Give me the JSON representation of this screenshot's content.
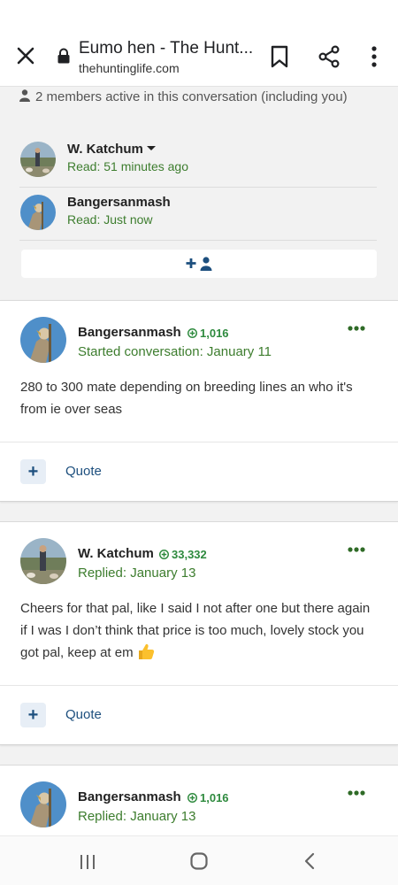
{
  "browser": {
    "title": "Eumo hen - The Hunt...",
    "url": "thehuntinglife.com"
  },
  "members": {
    "summary": "2 members active in this conversation (including you)",
    "list": [
      {
        "name": "W. Katchum",
        "read": "Read: 51 minutes ago",
        "has_dropdown": true
      },
      {
        "name": "Bangersanmash",
        "read": "Read: Just now",
        "has_dropdown": false
      }
    ],
    "invite_icon": "add-user-icon"
  },
  "messages": [
    {
      "author": "Bangersanmash",
      "score": "1,016",
      "meta": "Started conversation: January 11",
      "body": "280 to 300 mate depending on breeding lines an who it's from ie over seas",
      "quote_label": "Quote"
    },
    {
      "author": "W. Katchum",
      "score": "33,332",
      "meta": "Replied: January 13",
      "body": "Cheers for that pal, like I said I not after one but there again if I was I don’t think that price is too much, lovely stock you got pal, keep at em",
      "emoji": "thumbs-up-icon",
      "quote_label": "Quote"
    },
    {
      "author": "Bangersanmash",
      "score": "1,016",
      "meta": "Replied: January 13"
    }
  ],
  "colors": {
    "green_meta": "#3d7d2e",
    "score_green": "#2e8a3e",
    "quote_blue": "#1d4f7e",
    "background": "#f2f2f2"
  }
}
